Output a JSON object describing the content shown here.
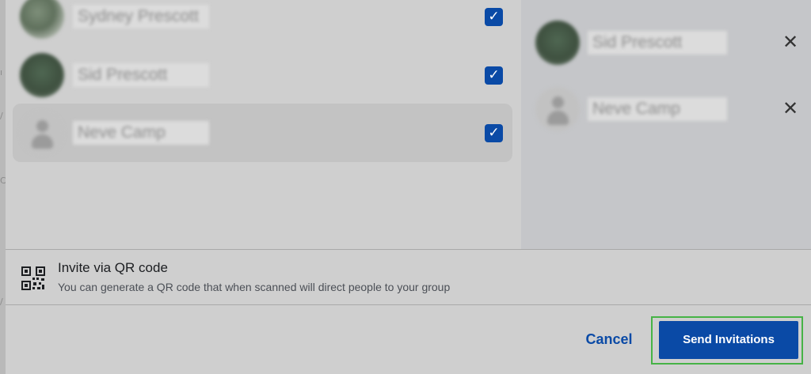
{
  "friends_list": [
    {
      "name": "Sydney Prescott",
      "selected": true,
      "avatar": "photo"
    },
    {
      "name": "Sid Prescott",
      "selected": true,
      "avatar": "photo"
    },
    {
      "name": "Neve Camp",
      "selected": true,
      "avatar": "default-silhouette"
    }
  ],
  "selected_panel": [
    {
      "name": "Sid Prescott",
      "remove_icon": "close-icon",
      "remove_glyph": "✕"
    },
    {
      "name": "Neve Camp",
      "remove_icon": "close-icon",
      "remove_glyph": "✕"
    }
  ],
  "checkbox_glyph": "✓",
  "qr_invite": {
    "icon": "qr-code-icon",
    "title": "Invite via QR code",
    "description": "You can generate a QR code that when scanned will direct people to your group"
  },
  "footer": {
    "cancel_label": "Cancel",
    "send_label": "Send Invitations"
  },
  "colors": {
    "primary": "#0a4aa6",
    "highlight_outline": "#46b346",
    "overlay": "#cfcfcf"
  }
}
